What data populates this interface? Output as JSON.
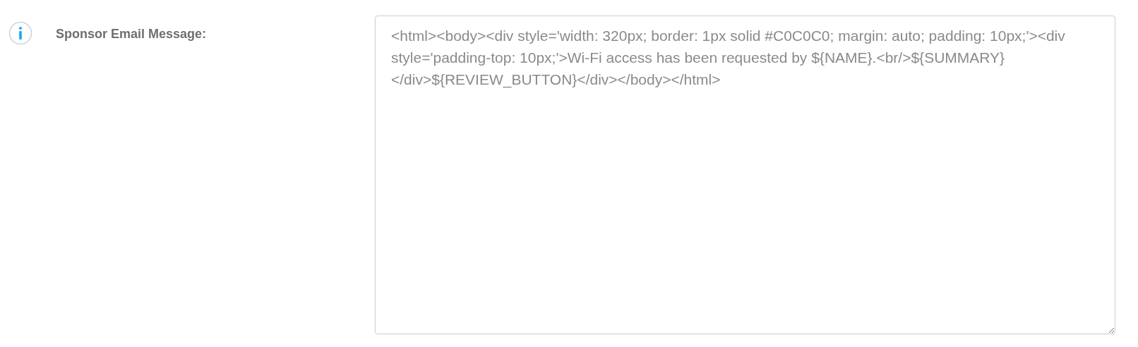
{
  "field": {
    "label": "Sponsor Email Message:",
    "value": "<html><body><div style='width: 320px; border: 1px solid #C0C0C0; margin: auto; padding: 10px;'><div style='padding-top: 10px;'>Wi-Fi access has been requested by ${NAME}.<br/>${SUMMARY}</div>${REVIEW_BUTTON}</div></body></html>"
  }
}
